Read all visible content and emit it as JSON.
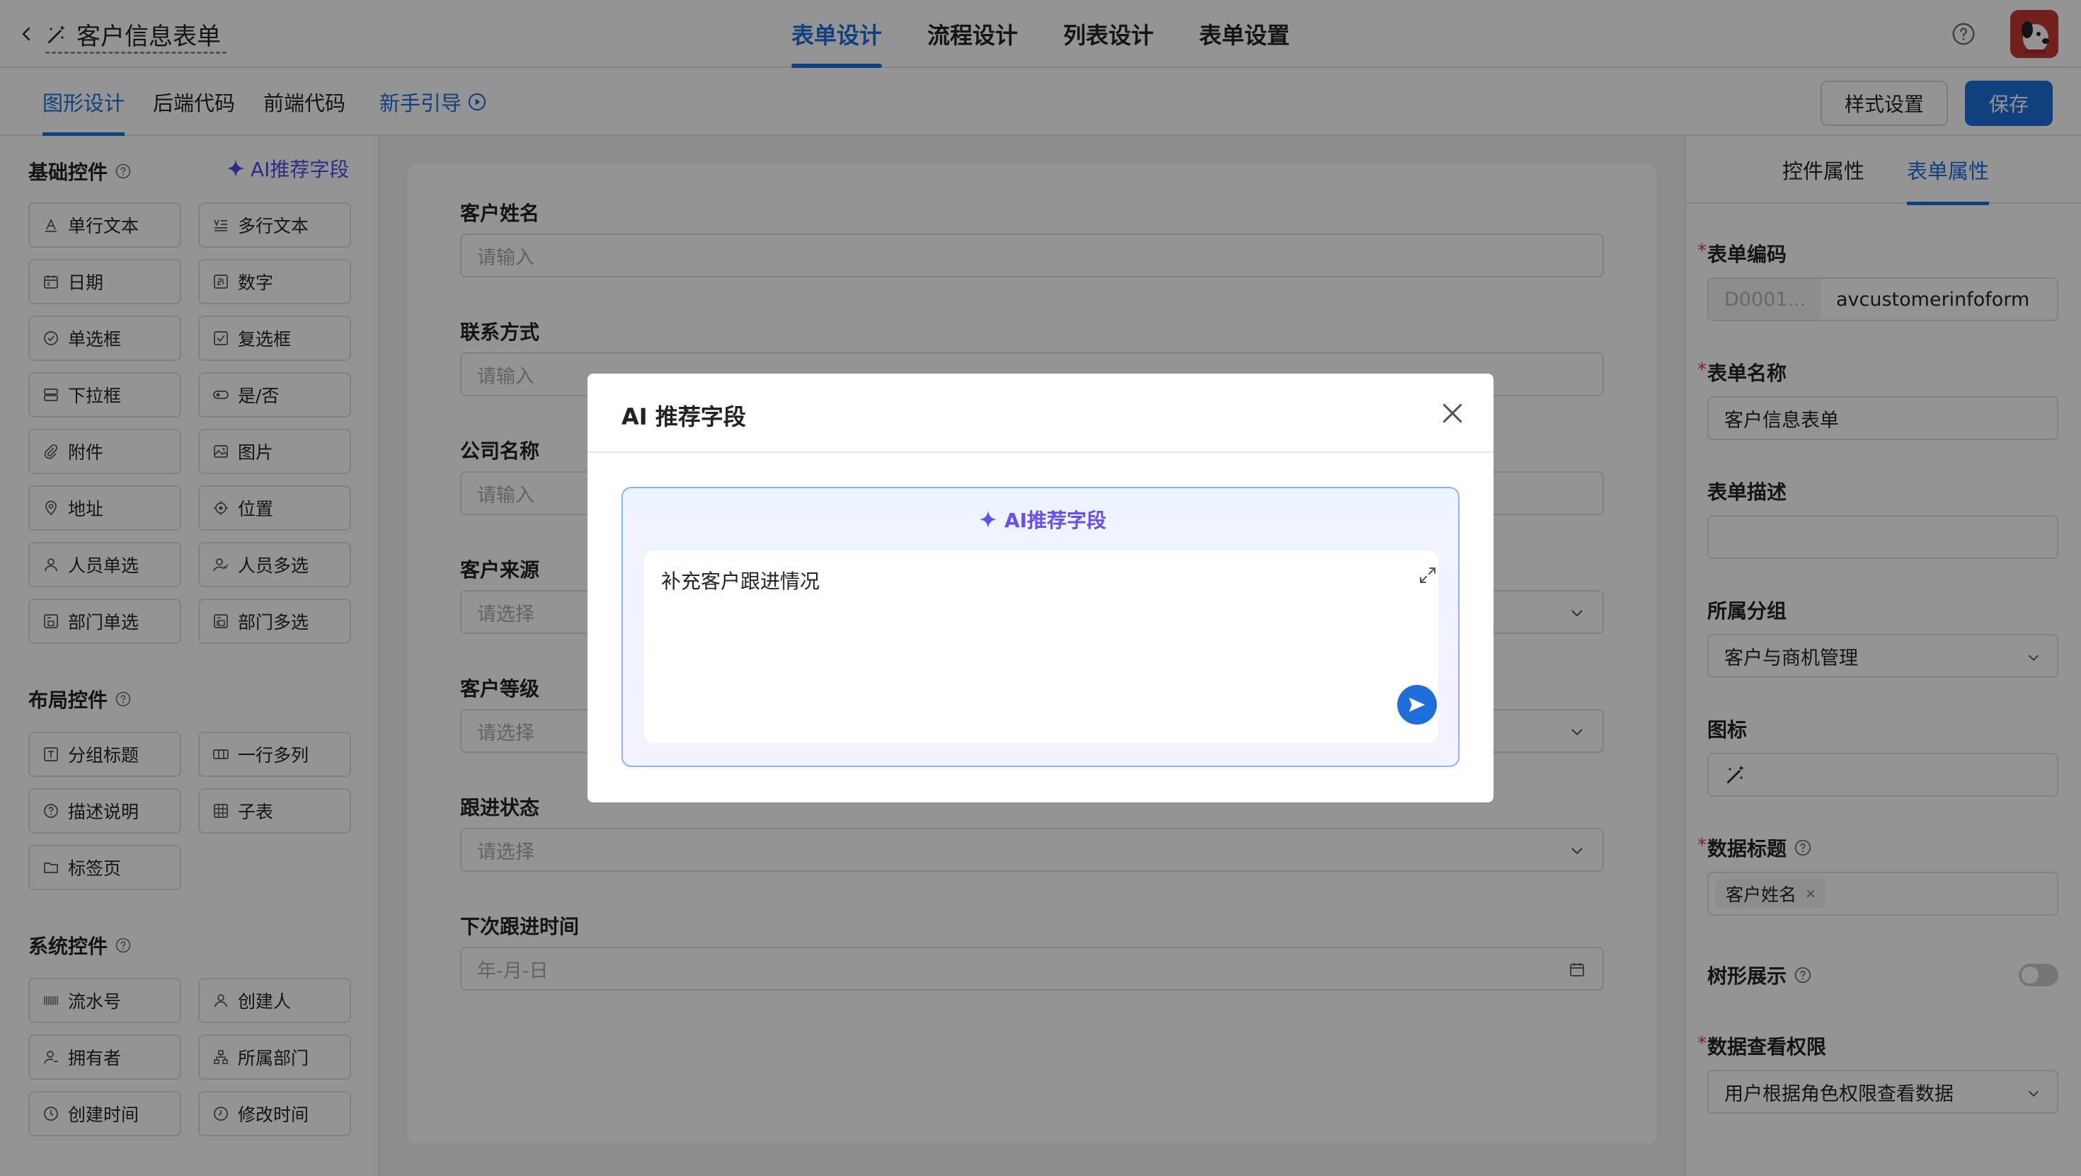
{
  "header": {
    "title": "客户信息表单",
    "tabs": [
      "表单设计",
      "流程设计",
      "列表设计",
      "表单设置"
    ]
  },
  "subheader": {
    "tabs": [
      "图形设计",
      "后端代码",
      "前端代码"
    ],
    "guide": "新手引导",
    "style_button": "样式设置",
    "save_button": "保存"
  },
  "left": {
    "basic_title": "基础控件",
    "ai_recommend": "AI推荐字段",
    "basic": [
      "单行文本",
      "多行文本",
      "日期",
      "数字",
      "单选框",
      "复选框",
      "下拉框",
      "是/否",
      "附件",
      "图片",
      "地址",
      "位置",
      "人员单选",
      "人员多选",
      "部门单选",
      "部门多选"
    ],
    "layout_title": "布局控件",
    "layout": [
      "分组标题",
      "一行多列",
      "描述说明",
      "子表",
      "标签页"
    ],
    "system_title": "系统控件",
    "system": [
      "流水号",
      "创建人",
      "拥有者",
      "所属部门",
      "创建时间",
      "修改时间"
    ]
  },
  "form": {
    "fields": [
      {
        "label": "客户姓名",
        "placeholder": "请输入"
      },
      {
        "label": "联系方式",
        "placeholder": "请输入"
      },
      {
        "label": "公司名称",
        "placeholder": "请输入"
      },
      {
        "label": "客户来源",
        "placeholder": "请选择"
      },
      {
        "label": "客户等级",
        "placeholder": "请选择"
      },
      {
        "label": "跟进状态",
        "placeholder": "请选择"
      },
      {
        "label": "下次跟进时间",
        "placeholder": "年-月-日"
      }
    ]
  },
  "right": {
    "tabs": [
      "控件属性",
      "表单属性"
    ],
    "code_label": "表单编码",
    "code_prefix": "D0001...",
    "code_value": "avcustomerinfoform",
    "name_label": "表单名称",
    "name_value": "客户信息表单",
    "desc_label": "表单描述",
    "desc_value": "",
    "group_label": "所属分组",
    "group_value": "客户与商机管理",
    "icon_label": "图标",
    "data_title_label": "数据标题",
    "data_title_tag": "客户姓名",
    "tree_label": "树形展示",
    "permission_label": "数据查看权限",
    "permission_value": "用户根据角色权限查看数据"
  },
  "modal": {
    "title": "AI 推荐字段",
    "box_title": "AI推荐字段",
    "input_text": "补充客户跟进情况"
  },
  "colors": {
    "primary": "#1e6fd9",
    "ai_purple": "#6a4ff0",
    "required": "#e03b3b"
  }
}
